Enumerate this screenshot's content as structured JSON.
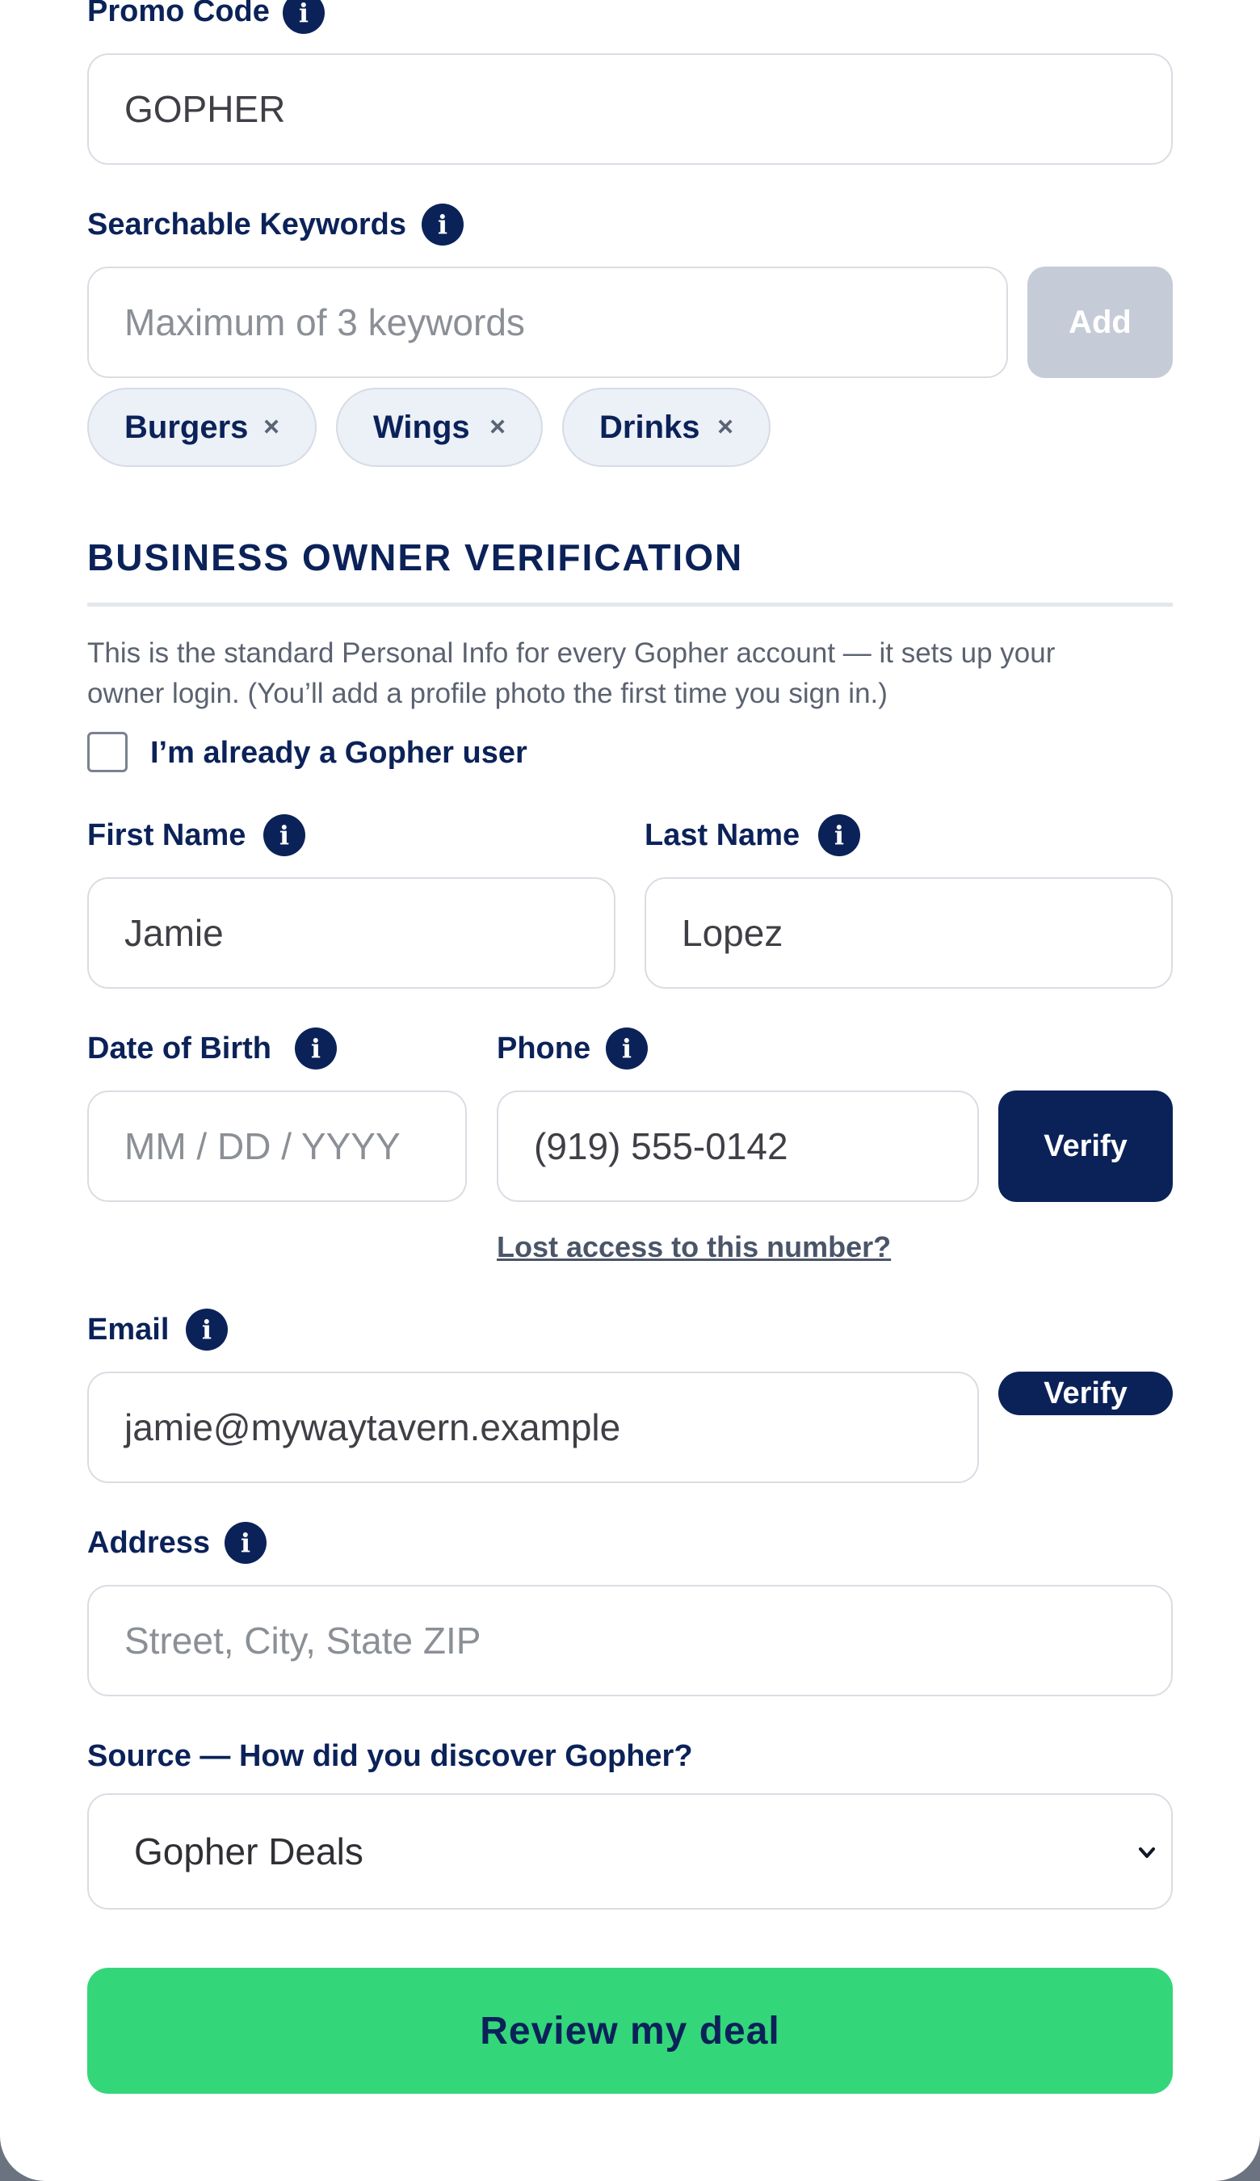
{
  "form": {
    "promo": {
      "label": "Promo Code",
      "value": "GOPHER"
    },
    "keywords": {
      "label": "Searchable Keywords",
      "placeholder": "Maximum of 3 keywords",
      "add_label": "Add",
      "chips": [
        "Burgers",
        "Wings",
        "Drinks"
      ],
      "remove_glyph": "×"
    },
    "section": {
      "title": "BUSINESS OWNER VERIFICATION",
      "description_line1": "This is the standard Personal Info for every Gopher account — it sets up your",
      "description_line2": "owner login. (You’ll add a profile photo the first time you sign in.)"
    },
    "already_user": {
      "label": "I’m already a Gopher user",
      "checked": false
    },
    "first_name": {
      "label": "First Name",
      "value": "Jamie"
    },
    "last_name": {
      "label": "Last Name",
      "value": "Lopez"
    },
    "dob": {
      "label": "Date of Birth",
      "placeholder": "MM / DD / YYYY"
    },
    "phone": {
      "label": "Phone",
      "value": "(919) 555-0142",
      "verify_label": "Verify",
      "lost_access_label": "Lost access to this number?"
    },
    "email": {
      "label": "Email",
      "value": "jamie@mywaytavern.example",
      "verify_label": "Verify"
    },
    "address": {
      "label": "Address",
      "placeholder": "Street, City, State ZIP"
    },
    "source": {
      "label": "Source — How did you discover Gopher?",
      "selected": "Gopher Deals"
    },
    "submit_label": "Review my deal",
    "info_glyph": "i"
  },
  "colors": {
    "navy": "#0b2259",
    "green": "#34d67a",
    "chip_bg": "#ecf0f7",
    "disabled_button": "#c5ccd8",
    "backdrop": "#6b7280"
  },
  "icons": {
    "info": "info-icon",
    "chip_remove": "close-icon",
    "select": "chevron-down-icon"
  }
}
